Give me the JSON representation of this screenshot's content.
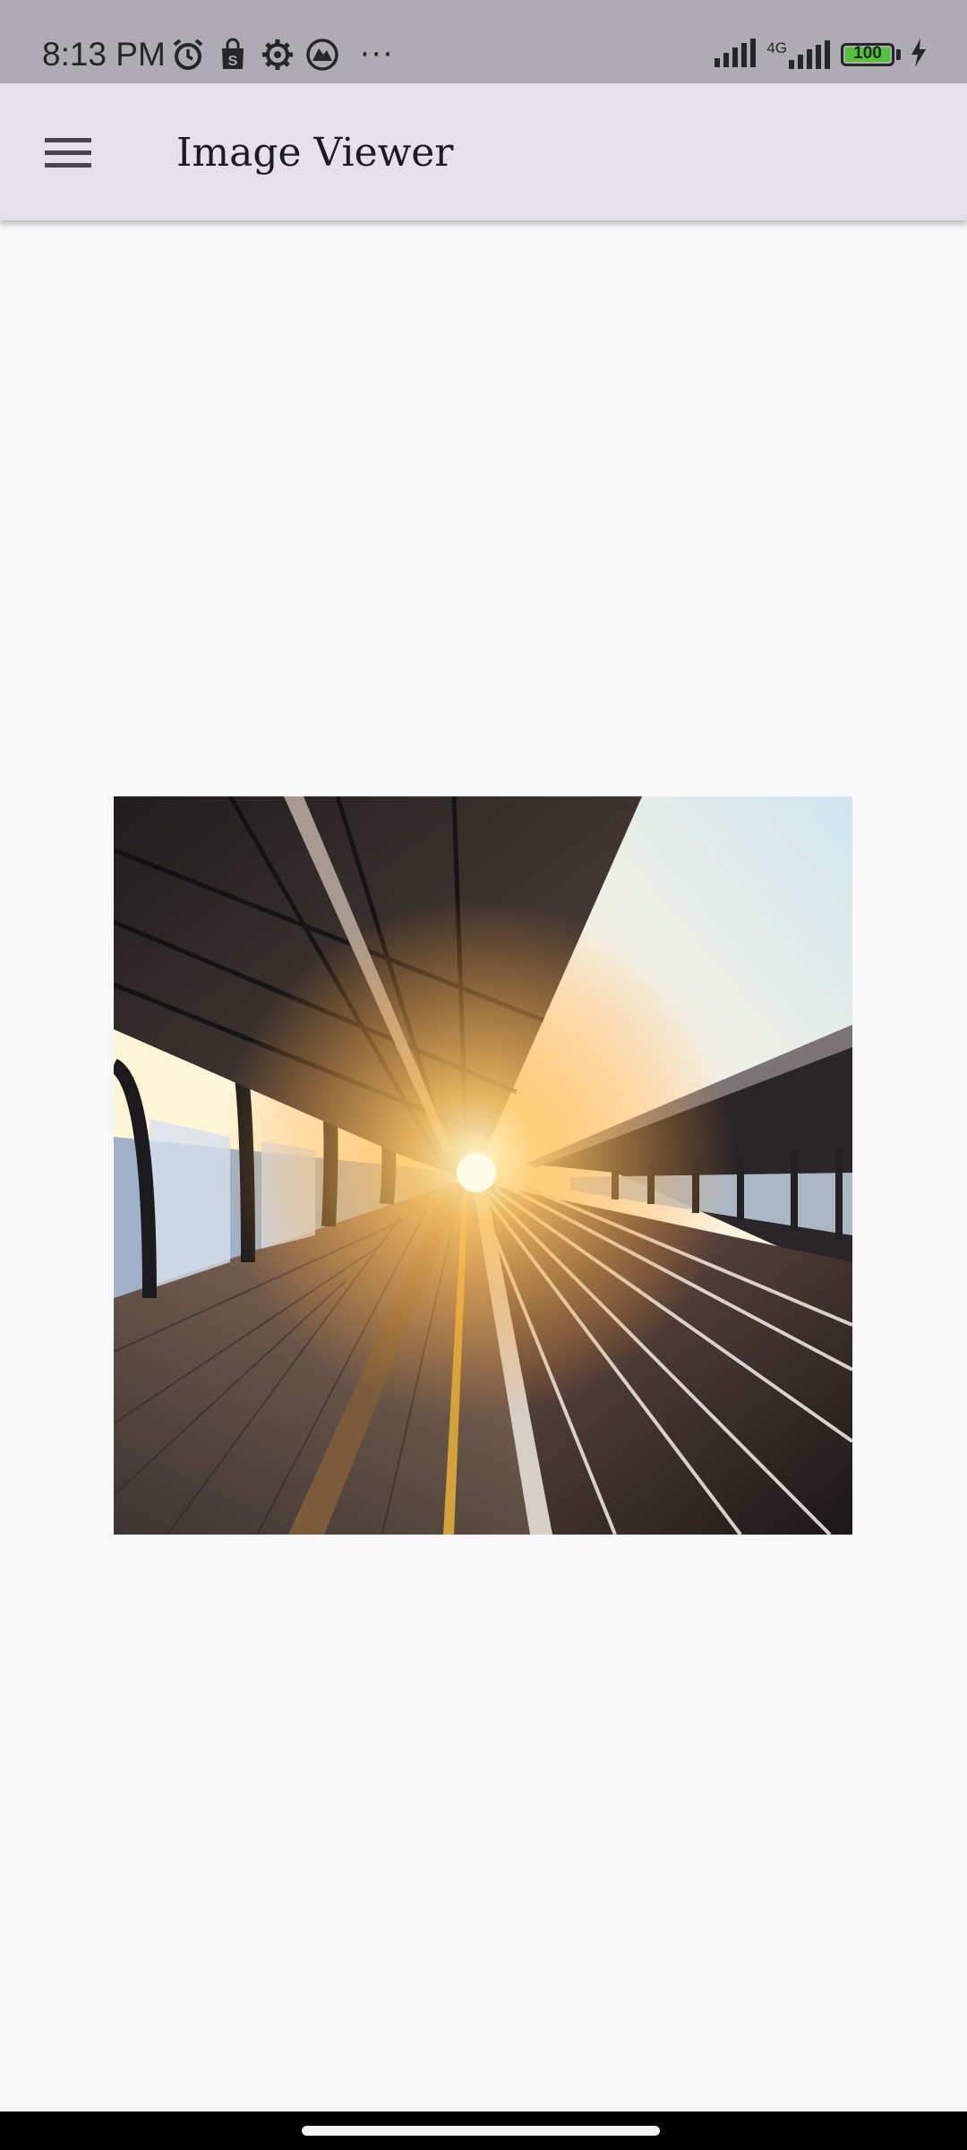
{
  "status_bar": {
    "time": "8:13 PM",
    "network_label": "4G",
    "battery_level": "100",
    "more_label": "···",
    "icons": [
      "alarm-icon",
      "shopping-bag-icon",
      "settings-icon",
      "game-icon",
      "signal-icon",
      "network-4g-icon",
      "signal-icon",
      "battery-icon",
      "charging-bolt-icon"
    ]
  },
  "app_bar": {
    "title": "Image Viewer",
    "menu_icon": "hamburger-menu-icon"
  },
  "image": {
    "subject": "train-station-platform-photo"
  },
  "colors": {
    "status_bar_bg": "#aeacb2",
    "app_bar_bg": "#e5e1ea",
    "content_bg": "#f8f8f8",
    "battery_green": "#54c13a"
  }
}
